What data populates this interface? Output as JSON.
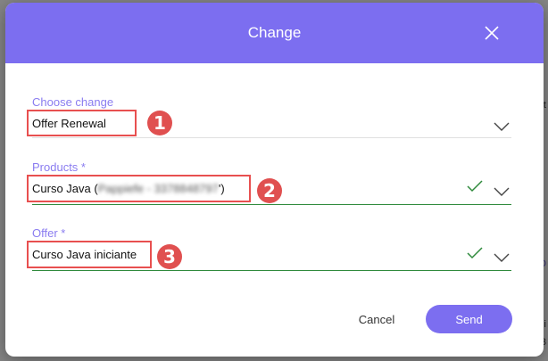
{
  "background": {
    "fragments": [
      "ot",
      "O",
      "Ni",
      "3"
    ]
  },
  "modal": {
    "title": "Change",
    "close_icon": "close-icon"
  },
  "form": {
    "choose_change": {
      "label": "Choose change",
      "value": "Offer Renewal"
    },
    "products": {
      "label": "Products *",
      "value_prefix": "Curso Java (",
      "value_redacted": "Pappiefe - 3378848797",
      "value_suffix": "')"
    },
    "offer": {
      "label": "Offer *",
      "value": "Curso Java iniciante"
    }
  },
  "annotations": [
    "1",
    "2",
    "3"
  ],
  "buttons": {
    "cancel": "Cancel",
    "send": "Send"
  },
  "colors": {
    "accent": "#7c6ef0",
    "valid": "#2f8a3c",
    "annotation": "#e05050"
  }
}
